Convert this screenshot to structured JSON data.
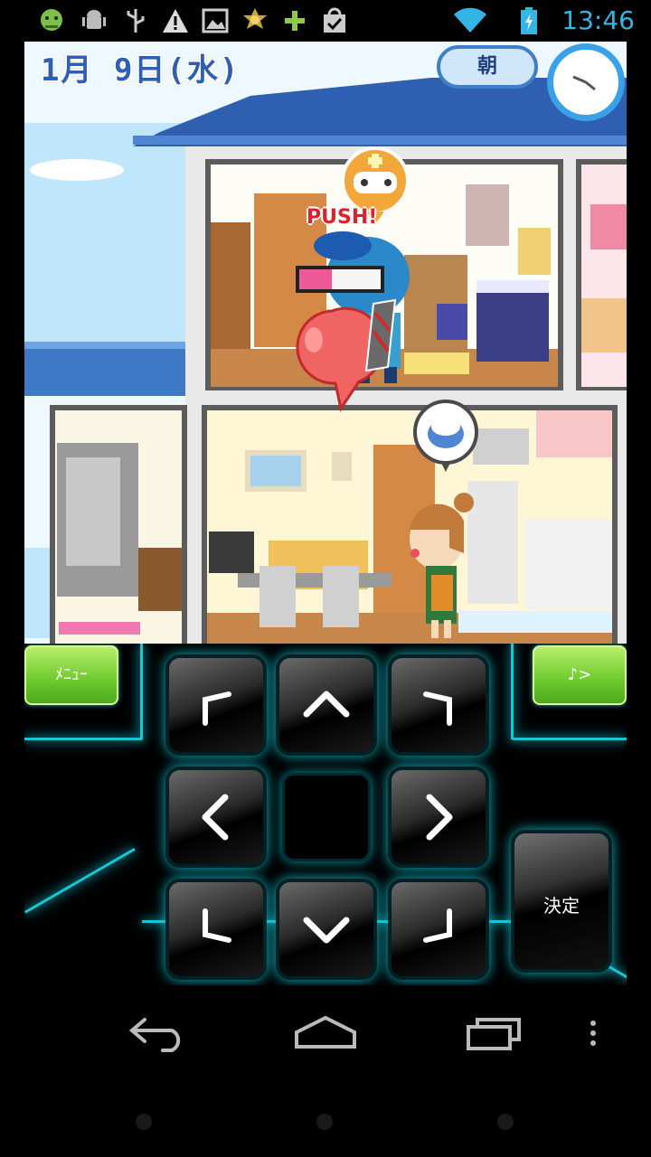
{
  "status_bar": {
    "time": "13:46",
    "icons": [
      "android-face-icon",
      "android-debug-icon",
      "usb-icon",
      "warning-icon",
      "image-icon",
      "sun-badge-icon",
      "plus-icon",
      "shopping-bag-check-icon",
      "wifi-icon",
      "battery-charging-icon"
    ],
    "accent_color": "#33b5e5"
  },
  "game": {
    "date": "1月  9日(水)",
    "time_of_day": "朝",
    "push_label": "PUSH!",
    "gauge_level": 0.4
  },
  "controller": {
    "menu_label": "ﾒﾆｭｰ",
    "sound_label": "♪>",
    "confirm_label": "決定",
    "dpad": [
      "up-left",
      "up",
      "up-right",
      "left",
      "center",
      "right",
      "down-left",
      "down",
      "down-right"
    ],
    "glow_color": "#17c7d6"
  },
  "nav": {
    "buttons": [
      "back-icon",
      "home-icon",
      "recent-apps-icon",
      "overflow-menu-icon"
    ]
  }
}
